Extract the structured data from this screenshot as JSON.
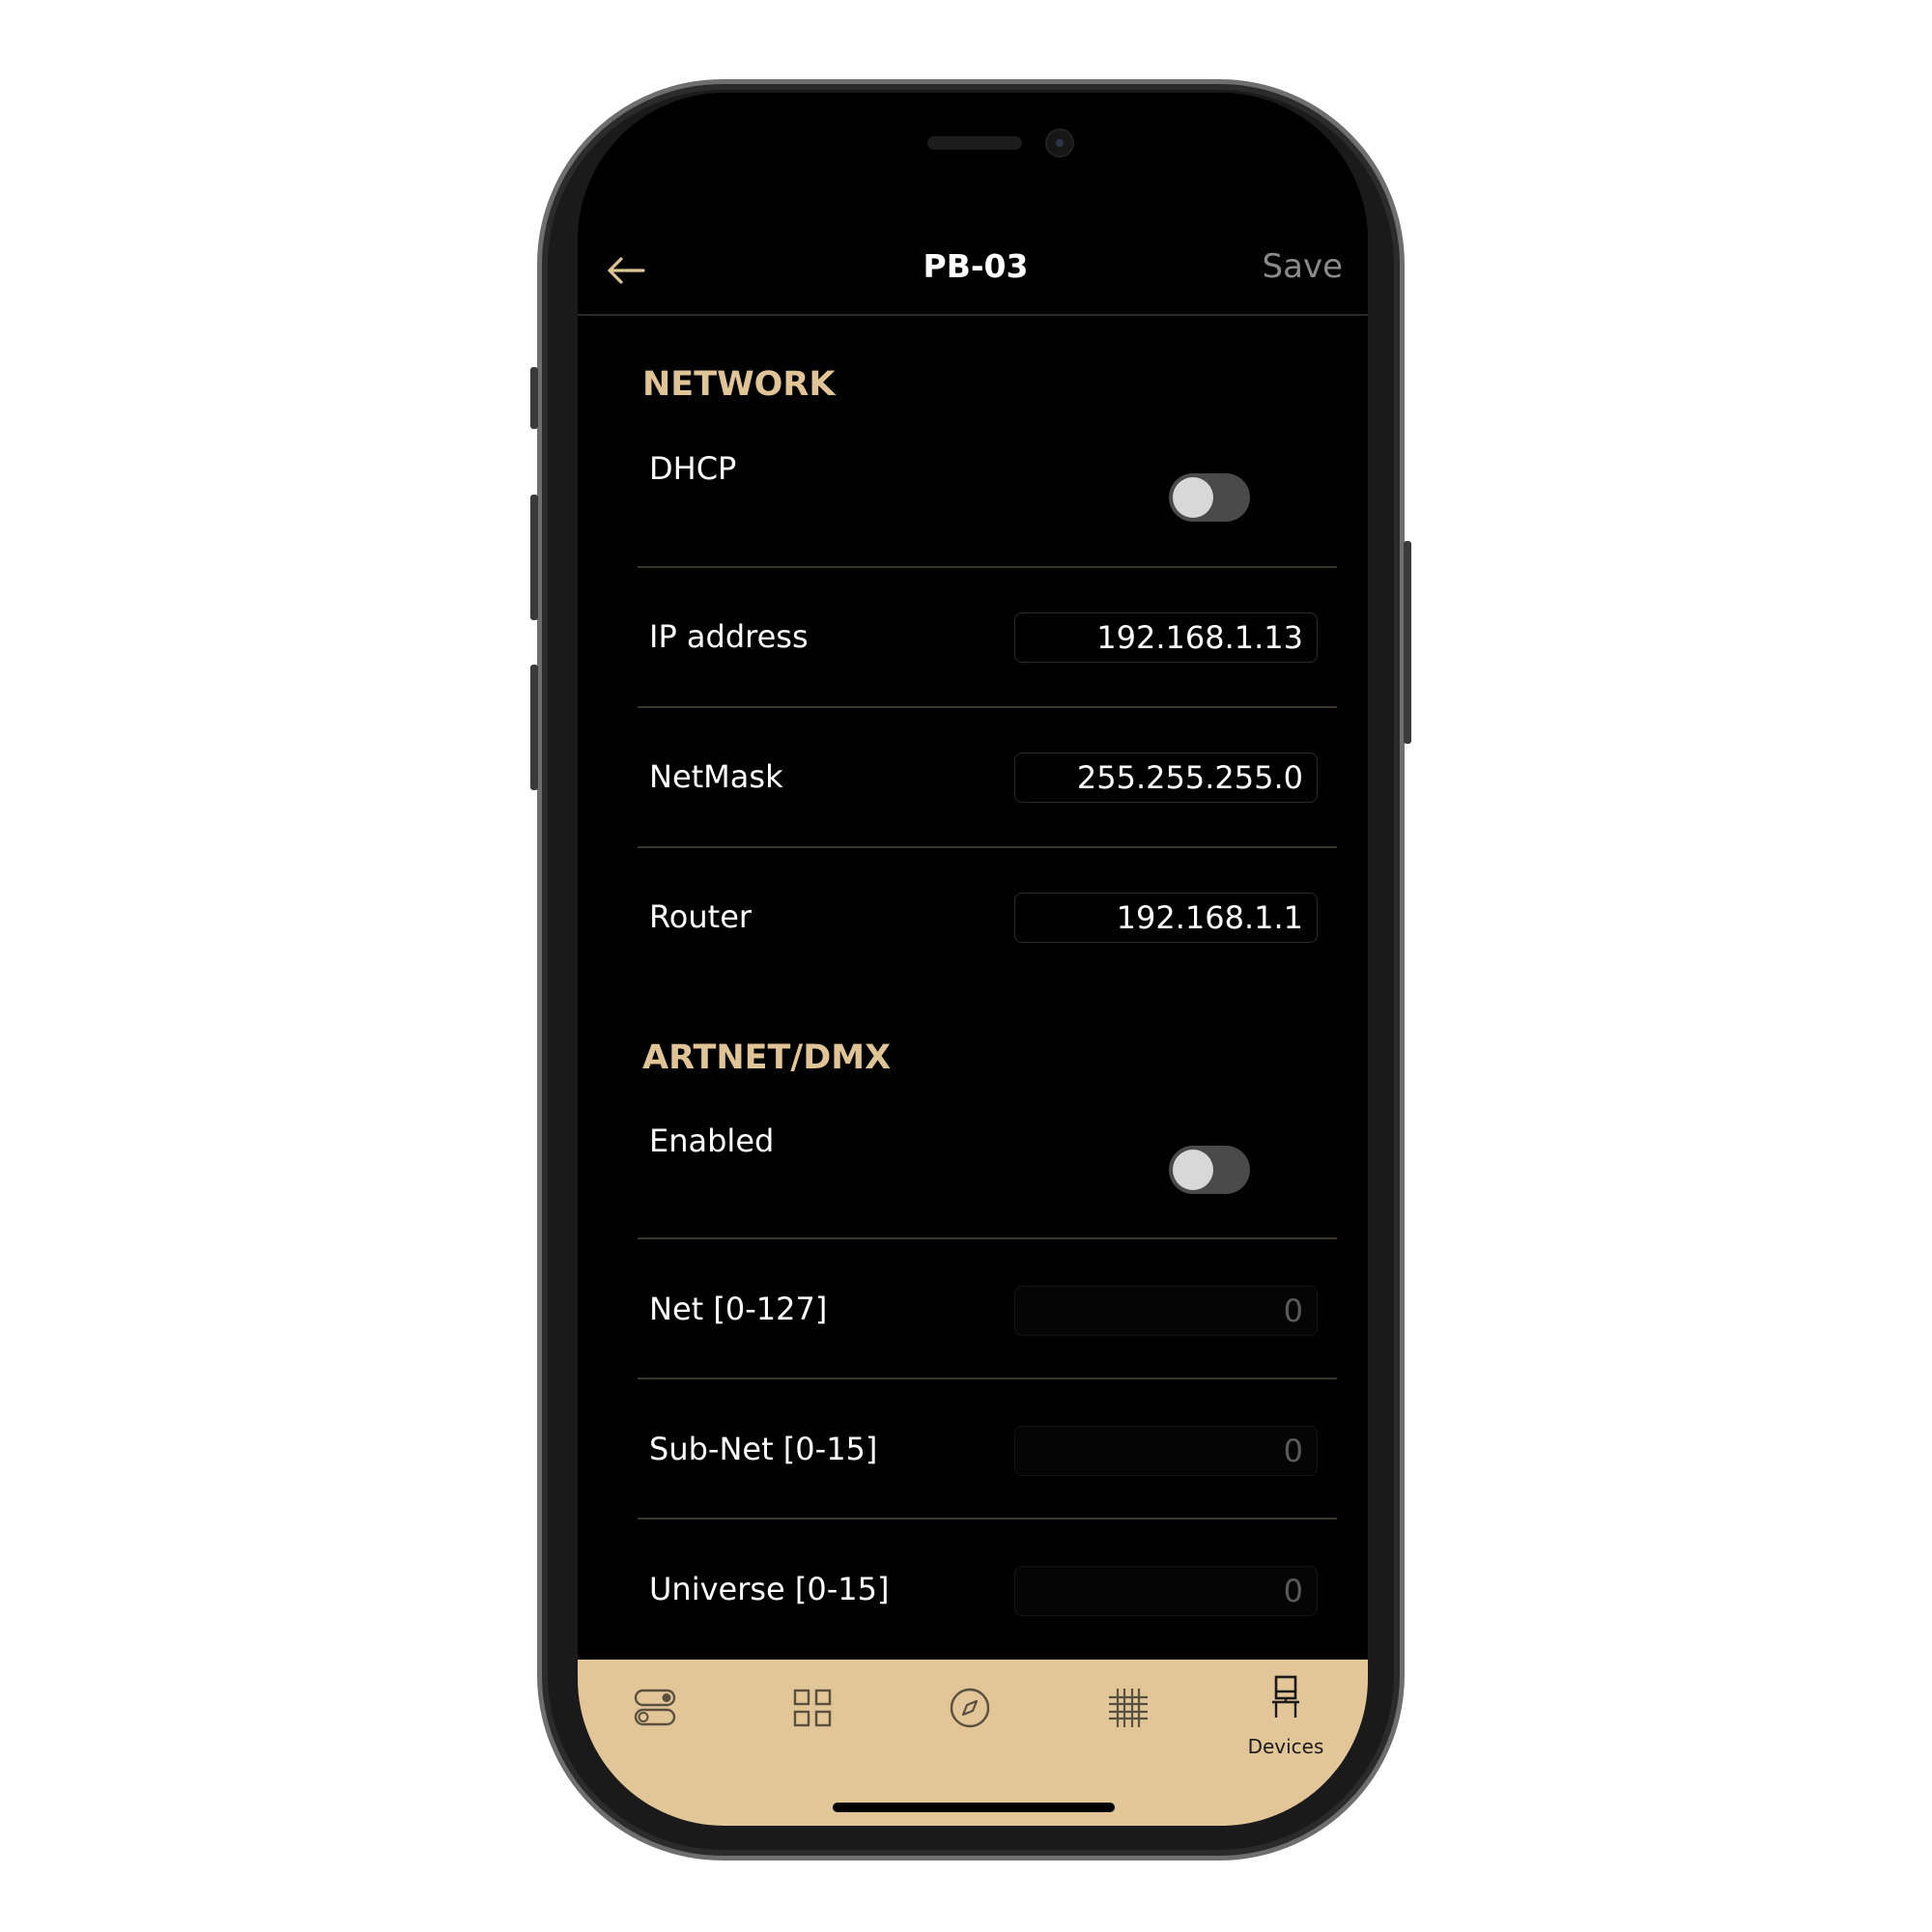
{
  "header": {
    "title": "PB-03",
    "save_label": "Save",
    "back_icon": "arrow-left-icon"
  },
  "network": {
    "section_title": "NETWORK",
    "dhcp": {
      "label": "DHCP",
      "enabled": false
    },
    "ip_address": {
      "label": "IP address",
      "value": "192.168.1.13"
    },
    "netmask": {
      "label": "NetMask",
      "value": "255.255.255.0"
    },
    "router": {
      "label": "Router",
      "value": "192.168.1.1"
    }
  },
  "artnet": {
    "section_title": "ARTNET/DMX",
    "enabled": {
      "label": "Enabled",
      "enabled": false
    },
    "net": {
      "label": "Net [0-127]",
      "value": "0"
    },
    "subnet": {
      "label": "Sub-Net [0-15]",
      "value": "0"
    },
    "universe": {
      "label": "Universe [0-15]",
      "value": "0"
    }
  },
  "tabbar": {
    "tabs": [
      {
        "icon": "toggles-icon",
        "label": ""
      },
      {
        "icon": "grid-icon",
        "label": ""
      },
      {
        "icon": "compass-icon",
        "label": ""
      },
      {
        "icon": "matrix-icon",
        "label": ""
      },
      {
        "icon": "device-lamp-icon",
        "label": "Devices",
        "active": true
      }
    ]
  },
  "colors": {
    "accent": "#e0c495",
    "tabbar_bg": "#e2c698",
    "background": "#000000",
    "save_inactive": "#8a8a8a"
  }
}
